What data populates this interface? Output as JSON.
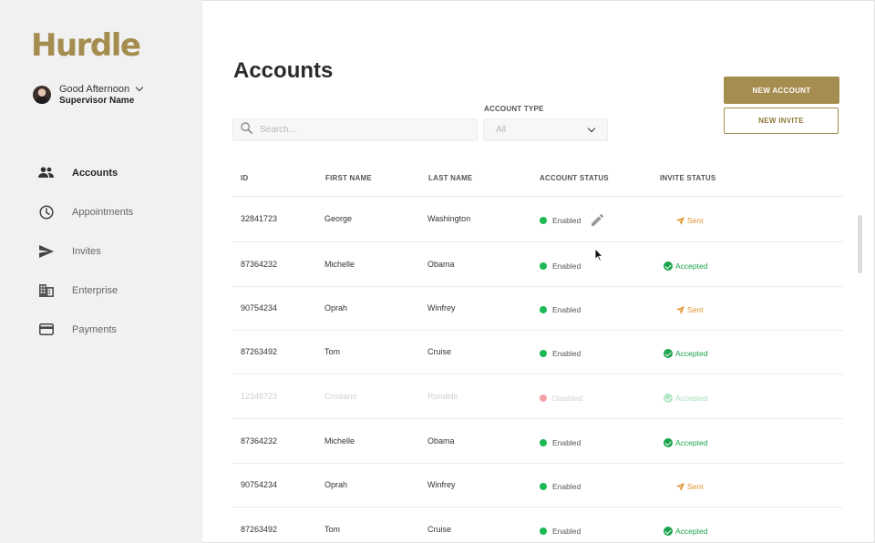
{
  "app": {
    "logo_text": "Hurdle"
  },
  "user": {
    "greeting": "Good Afternoon",
    "name": "Supervisor Name"
  },
  "sidebar": {
    "items": [
      {
        "label": "Accounts",
        "icon": "people-icon",
        "active": true
      },
      {
        "label": "Appointments",
        "icon": "clock-icon",
        "active": false
      },
      {
        "label": "Invites",
        "icon": "send-icon",
        "active": false
      },
      {
        "label": "Enterprise",
        "icon": "building-icon",
        "active": false
      },
      {
        "label": "Payments",
        "icon": "credit-card-icon",
        "active": false
      }
    ]
  },
  "page": {
    "title": "Accounts"
  },
  "search": {
    "placeholder": "Search..."
  },
  "account_type": {
    "label": "ACCOUNT TYPE",
    "value": "All"
  },
  "buttons": {
    "new_account": "NEW ACCOUNT",
    "new_invite": "NEW INVITE"
  },
  "colors": {
    "brand": "#a58d4f",
    "enabled": "#1db954",
    "disabled": "#f3a3a8",
    "sent": "#e0942d",
    "accepted": "#1aa34a"
  },
  "table": {
    "headers": {
      "id": "ID",
      "first_name": "FIRST NAME",
      "last_name": "LAST NAME",
      "account_status": "ACCOUNT STATUS",
      "invite_status": "INVITE STATUS"
    },
    "rows": [
      {
        "id": "32841723",
        "first": "George",
        "last": "Washington",
        "status": "Enabled",
        "invite": "Sent"
      },
      {
        "id": "87364232",
        "first": "Michelle",
        "last": "Obama",
        "status": "Enabled",
        "invite": "Accepted"
      },
      {
        "id": "90754234",
        "first": "Oprah",
        "last": "Winfrey",
        "status": "Enabled",
        "invite": "Sent"
      },
      {
        "id": "87263492",
        "first": "Tom",
        "last": "Cruise",
        "status": "Enabled",
        "invite": "Accepted"
      },
      {
        "id": "12348723",
        "first": "Cristiano",
        "last": "Ronaldo",
        "status": "Disabled",
        "invite": "Accepted"
      },
      {
        "id": "87364232",
        "first": "Michelle",
        "last": "Obama",
        "status": "Enabled",
        "invite": "Accepted"
      },
      {
        "id": "90754234",
        "first": "Oprah",
        "last": "Winfrey",
        "status": "Enabled",
        "invite": "Sent"
      },
      {
        "id": "87263492",
        "first": "Tom",
        "last": "Cruise",
        "status": "Enabled",
        "invite": "Accepted"
      }
    ]
  }
}
